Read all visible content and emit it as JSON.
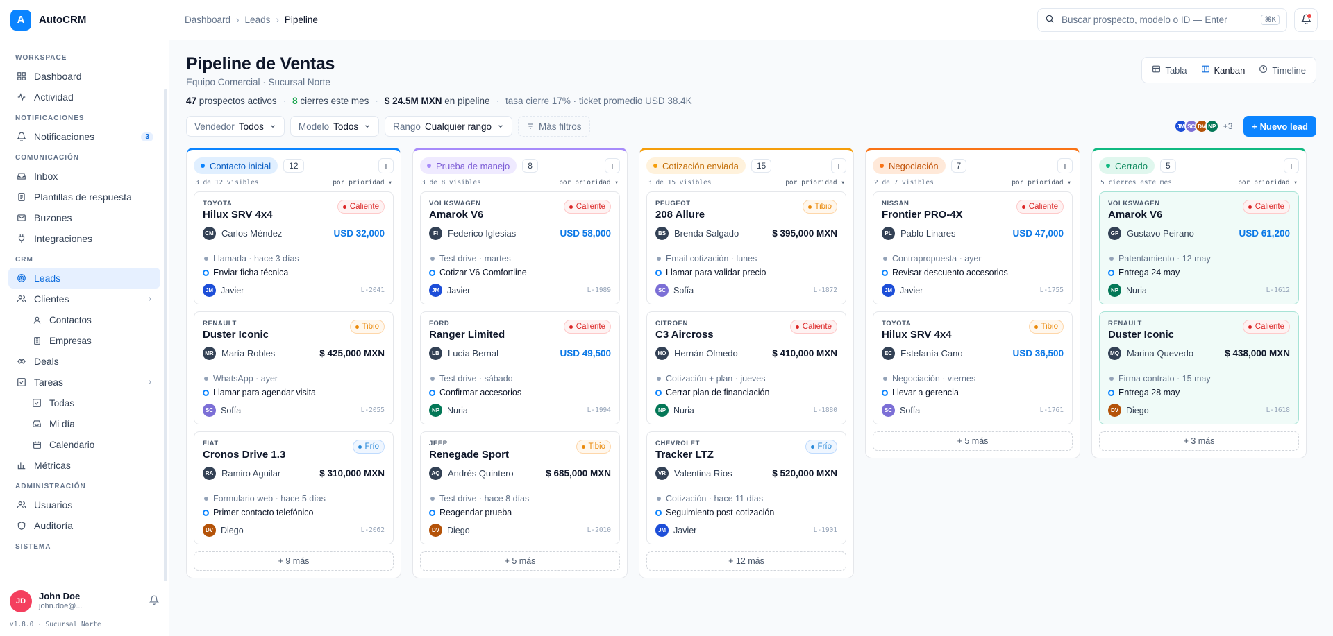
{
  "app": {
    "name": "AutoCRM",
    "logo_letter": "A",
    "version": "v1.8.0 · Sucursal Norte"
  },
  "sidebar": {
    "sections": [
      {
        "title": "WORKSPACE",
        "items": [
          {
            "label": "Dashboard",
            "icon": "grid-icon"
          },
          {
            "label": "Actividad",
            "icon": "activity-icon"
          }
        ]
      },
      {
        "title": "NOTIFICACIONES",
        "items": [
          {
            "label": "Notificaciones",
            "icon": "bell-icon",
            "badge": "3"
          }
        ]
      },
      {
        "title": "COMUNICACIÓN",
        "items": [
          {
            "label": "Inbox",
            "icon": "inbox-icon"
          },
          {
            "label": "Plantillas de respuesta",
            "icon": "document-icon"
          },
          {
            "label": "Buzones",
            "icon": "mail-icon"
          },
          {
            "label": "Integraciones",
            "icon": "plug-icon"
          }
        ]
      },
      {
        "title": "CRM",
        "items": [
          {
            "label": "Leads",
            "icon": "target-icon",
            "active": true
          },
          {
            "label": "Clientes",
            "icon": "users-icon",
            "chevron": true
          },
          {
            "label": "Contactos",
            "icon": "user-icon",
            "sub": true
          },
          {
            "label": "Empresas",
            "icon": "building-icon",
            "sub": true
          },
          {
            "label": "Deals",
            "icon": "handshake-icon"
          },
          {
            "label": "Tareas",
            "icon": "checkbox-icon",
            "chevron": true
          },
          {
            "label": "Todas",
            "icon": "checkbox-icon",
            "sub": true
          },
          {
            "label": "Mi día",
            "icon": "inbox-icon",
            "sub": true
          },
          {
            "label": "Calendario",
            "icon": "calendar-icon",
            "sub": true
          },
          {
            "label": "Métricas",
            "icon": "bar-chart-icon"
          }
        ]
      },
      {
        "title": "ADMINISTRACIÓN",
        "items": [
          {
            "label": "Usuarios",
            "icon": "users-icon"
          },
          {
            "label": "Auditoría",
            "icon": "shield-icon"
          }
        ]
      },
      {
        "title": "SISTEMA",
        "items": []
      }
    ]
  },
  "user": {
    "initials": "JD",
    "name": "John Doe",
    "email": "john.doe@..."
  },
  "topbar": {
    "breadcrumbs": [
      "Dashboard",
      "Leads",
      "Pipeline"
    ],
    "search_placeholder": "Buscar prospecto, modelo o ID — Enter",
    "search_kbd": "⌘K"
  },
  "header": {
    "title": "Pipeline de Ventas",
    "subtitle": "Equipo Comercial · Sucursal Norte",
    "stats": {
      "active_count": "47",
      "active_label": "prospectos activos",
      "closed_count": "8",
      "closed_label": "cierres este mes",
      "pipeline_value": "$ 24.5M MXN",
      "pipeline_label": "en pipeline",
      "extra": "tasa cierre 17% · ticket promedio USD 38.4K"
    },
    "views": [
      {
        "label": "Tabla",
        "icon": "table-icon"
      },
      {
        "label": "Kanban",
        "icon": "kanban-icon",
        "active": true
      },
      {
        "label": "Timeline",
        "icon": "clock-icon"
      }
    ]
  },
  "filters": [
    {
      "label": "Vendedor",
      "value": "Todos"
    },
    {
      "label": "Modelo",
      "value": "Todos"
    },
    {
      "label": "Rango",
      "value": "Cualquier rango"
    }
  ],
  "more_filters": "Más filtros",
  "team_avatars": [
    {
      "initials": "JM",
      "color": "#1d4ed8"
    },
    {
      "initials": "SC",
      "color": "#7c6fd6"
    },
    {
      "initials": "DV",
      "color": "#b45309"
    },
    {
      "initials": "NP",
      "color": "#047857"
    }
  ],
  "team_more": "+3",
  "new_lead_label": "+ Nuevo lead",
  "columns": [
    {
      "name": "Contacto inicial",
      "count": "12",
      "visible": "3 de 12 visibles",
      "sort": "por prioridad",
      "color": "#0b84ff",
      "pill_bg": "#e0efff",
      "pill_fg": "#0b5fc4",
      "more": "+ 9 más",
      "cards": [
        {
          "brand": "TOYOTA",
          "model": "Hilux SRV 4x4",
          "temp": "Caliente",
          "tclass": "t-hot",
          "initials": "CM",
          "av": "#334155",
          "contact": "Carlos Méndez",
          "price": "USD 32,000",
          "usd": true,
          "activity": "Llamada · hace 3 días",
          "next": "Enviar ficha técnica",
          "owner": "Javier",
          "oi": "JM",
          "oc": "#1d4ed8",
          "id": "L-2041"
        },
        {
          "brand": "RENAULT",
          "model": "Duster Iconic",
          "temp": "Tibio",
          "tclass": "t-warm",
          "initials": "MR",
          "av": "#334155",
          "contact": "María Robles",
          "price": "$ 425,000 MXN",
          "usd": false,
          "activity": "WhatsApp · ayer",
          "next": "Llamar para agendar visita",
          "owner": "Sofía",
          "oi": "SC",
          "oc": "#7c6fd6",
          "id": "L-2055"
        },
        {
          "brand": "FIAT",
          "model": "Cronos Drive 1.3",
          "temp": "Frío",
          "tclass": "t-cold",
          "initials": "RA",
          "av": "#334155",
          "contact": "Ramiro Aguilar",
          "price": "$ 310,000 MXN",
          "usd": false,
          "activity": "Formulario web · hace 5 días",
          "next": "Primer contacto telefónico",
          "owner": "Diego",
          "oi": "DV",
          "oc": "#b45309",
          "id": "L-2062"
        }
      ]
    },
    {
      "name": "Prueba de manejo",
      "count": "8",
      "visible": "3 de 8 visibles",
      "sort": "por prioridad",
      "color": "#a78bfa",
      "pill_bg": "#efeaff",
      "pill_fg": "#7c5cd6",
      "more": "+ 5 más",
      "cards": [
        {
          "brand": "VOLKSWAGEN",
          "model": "Amarok V6",
          "temp": "Caliente",
          "tclass": "t-hot",
          "initials": "FI",
          "av": "#334155",
          "contact": "Federico Iglesias",
          "price": "USD 58,000",
          "usd": true,
          "activity": "Test drive · martes",
          "next": "Cotizar V6 Comfortline",
          "owner": "Javier",
          "oi": "JM",
          "oc": "#1d4ed8",
          "id": "L-1989"
        },
        {
          "brand": "FORD",
          "model": "Ranger Limited",
          "temp": "Caliente",
          "tclass": "t-hot",
          "initials": "LB",
          "av": "#334155",
          "contact": "Lucía Bernal",
          "price": "USD 49,500",
          "usd": true,
          "activity": "Test drive · sábado",
          "next": "Confirmar accesorios",
          "owner": "Nuria",
          "oi": "NP",
          "oc": "#047857",
          "id": "L-1994"
        },
        {
          "brand": "JEEP",
          "model": "Renegade Sport",
          "temp": "Tibio",
          "tclass": "t-warm",
          "initials": "AQ",
          "av": "#334155",
          "contact": "Andrés Quintero",
          "price": "$ 685,000 MXN",
          "usd": false,
          "activity": "Test drive · hace 8 días",
          "next": "Reagendar prueba",
          "owner": "Diego",
          "oi": "DV",
          "oc": "#b45309",
          "id": "L-2010"
        }
      ]
    },
    {
      "name": "Cotización enviada",
      "count": "15",
      "visible": "3 de 15 visibles",
      "sort": "por prioridad",
      "color": "#f59e0b",
      "pill_bg": "#fff2dc",
      "pill_fg": "#c26d06",
      "more": "+ 12 más",
      "cards": [
        {
          "brand": "PEUGEOT",
          "model": "208 Allure",
          "temp": "Tibio",
          "tclass": "t-warm",
          "initials": "BS",
          "av": "#334155",
          "contact": "Brenda Salgado",
          "price": "$ 395,000 MXN",
          "usd": false,
          "activity": "Email cotización · lunes",
          "next": "Llamar para validar precio",
          "owner": "Sofía",
          "oi": "SC",
          "oc": "#7c6fd6",
          "id": "L-1872"
        },
        {
          "brand": "CITROËN",
          "model": "C3 Aircross",
          "temp": "Caliente",
          "tclass": "t-hot",
          "initials": "HO",
          "av": "#334155",
          "contact": "Hernán Olmedo",
          "price": "$ 410,000 MXN",
          "usd": false,
          "activity": "Cotización + plan · jueves",
          "next": "Cerrar plan de financiación",
          "owner": "Nuria",
          "oi": "NP",
          "oc": "#047857",
          "id": "L-1880"
        },
        {
          "brand": "CHEVROLET",
          "model": "Tracker LTZ",
          "temp": "Frío",
          "tclass": "t-cold",
          "initials": "VR",
          "av": "#334155",
          "contact": "Valentina Ríos",
          "price": "$ 520,000 MXN",
          "usd": false,
          "activity": "Cotización · hace 11 días",
          "next": "Seguimiento post-cotización",
          "owner": "Javier",
          "oi": "JM",
          "oc": "#1d4ed8",
          "id": "L-1901"
        }
      ]
    },
    {
      "name": "Negociación",
      "count": "7",
      "visible": "2 de 7 visibles",
      "sort": "por prioridad",
      "color": "#f97316",
      "pill_bg": "#ffe9d9",
      "pill_fg": "#c2540a",
      "more": "+ 5 más",
      "cards": [
        {
          "brand": "NISSAN",
          "model": "Frontier PRO-4X",
          "temp": "Caliente",
          "tclass": "t-hot",
          "initials": "PL",
          "av": "#334155",
          "contact": "Pablo Linares",
          "price": "USD 47,000",
          "usd": true,
          "activity": "Contrapropuesta · ayer",
          "next": "Revisar descuento accesorios",
          "owner": "Javier",
          "oi": "JM",
          "oc": "#1d4ed8",
          "id": "L-1755"
        },
        {
          "brand": "TOYOTA",
          "model": "Hilux SRV 4x4",
          "temp": "Tibio",
          "tclass": "t-warm",
          "initials": "EC",
          "av": "#334155",
          "contact": "Estefanía Cano",
          "price": "USD 36,500",
          "usd": true,
          "activity": "Negociación · viernes",
          "next": "Llevar a gerencia",
          "owner": "Sofía",
          "oi": "SC",
          "oc": "#7c6fd6",
          "id": "L-1761"
        }
      ]
    },
    {
      "name": "Cerrado",
      "count": "5",
      "visible": "5 cierres este mes",
      "sort": "por prioridad",
      "color": "#10b981",
      "pill_bg": "#e0f7ee",
      "pill_fg": "#0f8a5f",
      "more": "+ 3 más",
      "closed": true,
      "cards": [
        {
          "brand": "VOLKSWAGEN",
          "model": "Amarok V6",
          "temp": "Caliente",
          "tclass": "t-hot",
          "initials": "GP",
          "av": "#334155",
          "contact": "Gustavo Peirano",
          "price": "USD 61,200",
          "usd": true,
          "activity": "Patentamiento · 12 may",
          "next": "Entrega 24 may",
          "owner": "Nuria",
          "oi": "NP",
          "oc": "#047857",
          "id": "L-1612"
        },
        {
          "brand": "RENAULT",
          "model": "Duster Iconic",
          "temp": "Caliente",
          "tclass": "t-hot",
          "initials": "MQ",
          "av": "#334155",
          "contact": "Marina Quevedo",
          "price": "$ 438,000 MXN",
          "usd": false,
          "activity": "Firma contrato · 15 may",
          "next": "Entrega 28 may",
          "owner": "Diego",
          "oi": "DV",
          "oc": "#b45309",
          "id": "L-1618"
        }
      ]
    }
  ]
}
